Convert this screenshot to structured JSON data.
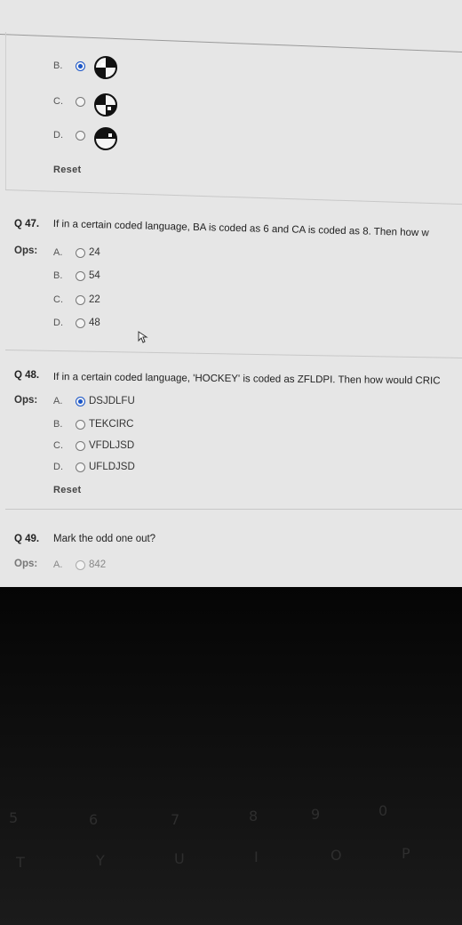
{
  "q46": {
    "options": [
      {
        "letter": "B.",
        "selected": true
      },
      {
        "letter": "C.",
        "selected": false
      },
      {
        "letter": "D.",
        "selected": false
      }
    ],
    "reset_label": "Reset"
  },
  "q47": {
    "number": "Q 47.",
    "text": "If in a certain coded language, BA is coded as 6 and CA is coded as 8. Then how w",
    "ops_label": "Ops:",
    "options": [
      {
        "letter": "A.",
        "text": "24",
        "selected": false
      },
      {
        "letter": "B.",
        "text": "54",
        "selected": false
      },
      {
        "letter": "C.",
        "text": "22",
        "selected": false
      },
      {
        "letter": "D.",
        "text": "48",
        "selected": false
      }
    ]
  },
  "q48": {
    "number": "Q 48.",
    "text": "If in a certain coded language, 'HOCKEY' is coded as ZFLDPI. Then how would CRIC",
    "ops_label": "Ops:",
    "options": [
      {
        "letter": "A.",
        "text": "DSJDLFU",
        "selected": true
      },
      {
        "letter": "B.",
        "text": "TEKCIRC",
        "selected": false
      },
      {
        "letter": "C.",
        "text": "VFDLJSD",
        "selected": false
      },
      {
        "letter": "D.",
        "text": "UFLDJSD",
        "selected": false
      }
    ],
    "reset_label": "Reset"
  },
  "q49": {
    "number": "Q 49.",
    "text": "Mark the odd one out?",
    "ops_label": "Ops:",
    "options": [
      {
        "letter": "A.",
        "text": "842",
        "selected": false
      }
    ]
  },
  "keyboard": {
    "row1": [
      "5",
      "6",
      "7",
      "8",
      "9",
      "0"
    ],
    "row2": [
      "T",
      "Y",
      "U",
      "I",
      "O",
      "P"
    ]
  },
  "colors": {
    "selected_radio": "#1a55c8",
    "screen_bg": "#e6e6e6"
  }
}
